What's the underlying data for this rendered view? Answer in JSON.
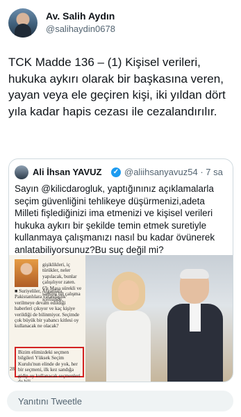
{
  "author": {
    "name": "Av. Salih Aydın",
    "handle": "@salihaydin0678",
    "avatar": "avatar-person-icon"
  },
  "tweet": {
    "text": "TCK Madde 136 – (1) Kişisel verileri, hukuka aykırı olarak bir başkasına veren, yayan veya ele geçiren kişi, iki yıldan dört yıla kadar hapis cezası ile cezalandırılır."
  },
  "quote": {
    "name": "Ali İhsan YAVUZ",
    "verified_icon": "verified-badge-icon",
    "handle_time": "@aliihsanyavuz54 · 7 sa",
    "text": "Sayın @kilicdarogluk, yaptığınınız açıklamalarla seçim güvenliğini tehlikeye düşürmenizi,adeta Milleti fişlediğinizi ima etmenizi ve kişisel verileri hukuka aykırı bir şekilde temin etmek suretiyle kullanmaya çalışmanızı nasıl bu kadar övünerek anlatabiliyorsunuz?Bu suç değil mi?",
    "image": {
      "column_text_top": "gişiklikleri, iç türükler, neler yapılacak, bunlar çalışılıyor zaten. 6'lı Masa sürekli ve samimi bir çalışma içerisinde.",
      "column_text_mid": "■ Suriyeliler, Afganlara, Pakistanlılara vatandaşlık verilmeye devam edildiği haberleri çıkıyor ve kaç kişiye verildiği de bilinmiyor. Seçimde çok büyük bir yabancı kitlesi oy kullanacak ne olacak?",
      "column_text_box": "Bizim elimizdeki seçmen bilgileri Yüksek Seçim Kurulu'nun elinde de yok, her bir seçmeni, ilk kez sandığa gidip oy kullanacak seçmenleri de bili",
      "page_number": "28"
    }
  },
  "reply": {
    "placeholder": "Yanıtını Tweetle"
  }
}
